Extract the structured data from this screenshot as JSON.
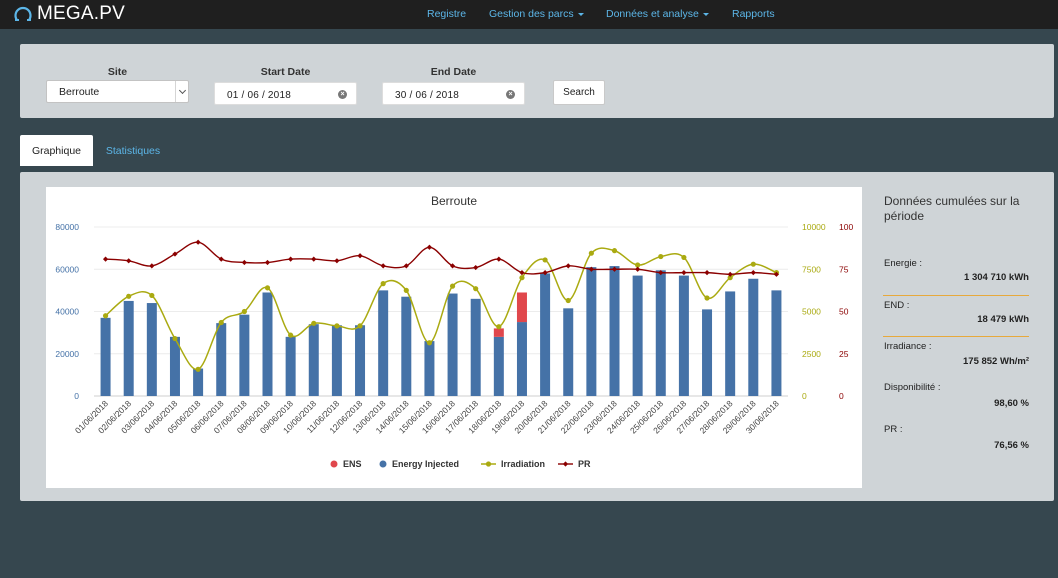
{
  "brand": {
    "name": "MEGA.PV"
  },
  "nav": {
    "items": [
      {
        "label": "Registre",
        "dropdown": false
      },
      {
        "label": "Gestion des parcs",
        "dropdown": true
      },
      {
        "label": "Données et analyse",
        "dropdown": true
      },
      {
        "label": "Rapports",
        "dropdown": false
      }
    ]
  },
  "filters": {
    "site_label": "Site",
    "site_value": "Berroute",
    "start_label": "Start Date",
    "start_value": "01 / 06 / 2018",
    "end_label": "End Date",
    "end_value": "30 / 06 / 2018",
    "search_label": "Search"
  },
  "tabs": [
    {
      "label": "Graphique",
      "active": true
    },
    {
      "label": "Statistiques",
      "active": false
    }
  ],
  "stats": {
    "title": "Données cumulées sur la période",
    "items": [
      {
        "label": "Energie :",
        "value": "1 304 710 kWh"
      },
      {
        "label": "END :",
        "value": "18 479 kWh"
      },
      {
        "label": "Irradiance :",
        "value": "175 852 Wh/m²"
      },
      {
        "label": "Disponibilité :",
        "value": "98,60 %"
      },
      {
        "label": "PR :",
        "value": "76,56 %"
      }
    ]
  },
  "colors": {
    "ens": "#e0474c",
    "energy": "#4572a7",
    "irradiation": "#aaaa11",
    "pr": "#8b0000",
    "nav_link": "#5cb6e8",
    "stat_divider": "#e7a93c"
  },
  "chart_data": {
    "type": "bar",
    "title": "Berroute",
    "categories": [
      "01/06/2018",
      "02/06/2018",
      "03/06/2018",
      "04/06/2018",
      "05/06/2018",
      "06/06/2018",
      "07/06/2018",
      "08/06/2018",
      "09/06/2018",
      "10/06/2018",
      "11/06/2018",
      "12/06/2018",
      "13/06/2018",
      "14/06/2018",
      "15/06/2018",
      "16/06/2018",
      "17/06/2018",
      "18/06/2018",
      "19/06/2018",
      "20/06/2018",
      "21/06/2018",
      "22/06/2018",
      "23/06/2018",
      "24/06/2018",
      "25/06/2018",
      "26/06/2018",
      "27/06/2018",
      "28/06/2018",
      "29/06/2018",
      "30/06/2018"
    ],
    "axes": {
      "left": {
        "ticks": [
          "0",
          "20000",
          "40000",
          "60000",
          "80000"
        ],
        "min": 0,
        "max": 80000
      },
      "right1": {
        "ticks": [
          "0",
          "2500",
          "5000",
          "7500",
          "10000"
        ],
        "min": 0,
        "max": 10000
      },
      "right2": {
        "ticks": [
          "0",
          "25",
          "50",
          "75",
          "100"
        ],
        "min": 0,
        "max": 100
      }
    },
    "grid": true,
    "legend_position": "bottom",
    "series": [
      {
        "name": "ENS",
        "type": "stacked-bar",
        "axis": "left",
        "color": "#e0474c",
        "values": [
          0,
          0,
          0,
          0,
          0,
          0,
          0,
          0,
          0,
          0,
          0,
          0,
          0,
          0,
          0,
          0,
          0,
          4000,
          14000,
          0,
          0,
          0,
          0,
          0,
          0,
          0,
          0,
          0,
          0,
          0
        ]
      },
      {
        "name": "Energy Injected",
        "type": "bar",
        "axis": "left",
        "color": "#4572a7",
        "values": [
          37000,
          45000,
          44000,
          28000,
          13000,
          34500,
          38500,
          49000,
          28000,
          34000,
          33500,
          33500,
          50000,
          47000,
          26000,
          48500,
          46000,
          28000,
          35000,
          58000,
          41500,
          61000,
          61500,
          57000,
          59500,
          57000,
          41000,
          49500,
          55500,
          50000
        ]
      },
      {
        "name": "Irradiation",
        "type": "line",
        "axis": "right1",
        "color": "#aaaa11",
        "values": [
          4750,
          5900,
          5950,
          3400,
          1580,
          4350,
          5000,
          6400,
          3600,
          4300,
          4150,
          4150,
          6650,
          6250,
          3150,
          6500,
          6350,
          4100,
          7000,
          8050,
          5650,
          8450,
          8600,
          7750,
          8250,
          8200,
          5800,
          7000,
          7800,
          7300
        ]
      },
      {
        "name": "PR",
        "type": "line",
        "axis": "right2",
        "color": "#8b0000",
        "values": [
          81,
          80,
          77,
          84,
          91,
          81,
          79,
          79,
          81,
          81,
          80,
          83,
          77,
          77,
          88,
          77,
          76,
          81,
          73,
          73,
          77,
          75,
          75,
          75,
          73,
          73,
          73,
          72,
          73,
          72
        ]
      }
    ]
  }
}
